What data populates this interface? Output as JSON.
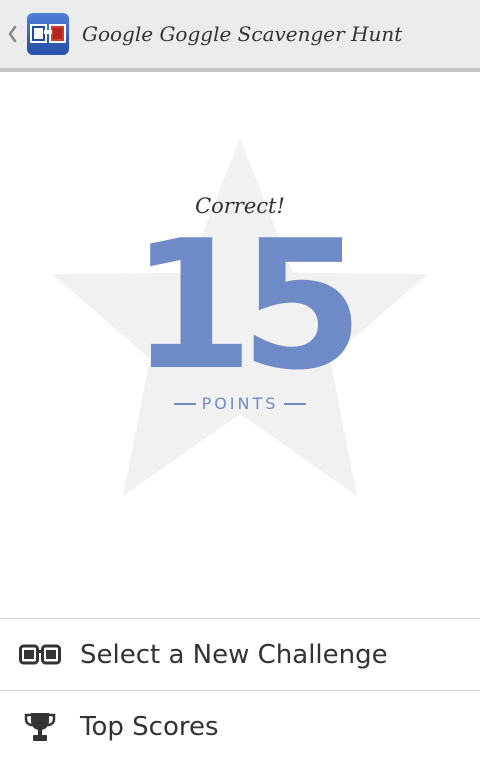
{
  "actionbar": {
    "title": "Google Goggle Scavenger Hunt",
    "icons": {
      "up": "chevron-left-icon",
      "app": "goggles-app-icon"
    }
  },
  "score": {
    "status_text": "Correct!",
    "points": "15",
    "unit_label": "POINTS",
    "accent_color": "#6e8bc7",
    "background_shape": "star-icon"
  },
  "menu": {
    "items": [
      {
        "label": "Select a New Challenge",
        "icon": "goggles-icon"
      },
      {
        "label": "Top Scores",
        "icon": "trophy-icon"
      }
    ]
  },
  "colors": {
    "actionbar_bg": "#ececec",
    "star_fill": "#f1f1f1",
    "text": "#333333",
    "divider": "#cfcfcf"
  }
}
